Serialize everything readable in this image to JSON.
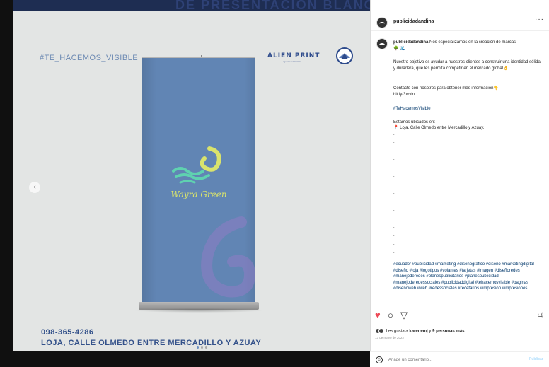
{
  "post_image": {
    "top_strip_text": "DE PRESENTACION BLANCOS",
    "hashtag": "#TE_HACEMOS_VISIBLE",
    "brand_name": "ALIEN PRINT",
    "brand_sub": "agencia publicitaria",
    "banner_logo": "Wayra Green",
    "phone": "098-365-4286",
    "address": "LOJA, CALLE OLMEDO ENTRE MERCADILLO Y AZUAY",
    "prev_icon": "‹",
    "colors": {
      "banner": "#6185b4",
      "text": "#33518a",
      "logo_yellow": "#d9e36c",
      "logo_green": "#5fd2b0"
    }
  },
  "header": {
    "username": "publicidadandina",
    "more": "···"
  },
  "caption": {
    "username": "publicidadandina",
    "line1": "Nos especializamos en la creación de marcas",
    "emojis1": "🌳 🌊",
    "p2": "Nuestro objetivo es ayudar a nuestros clientes a construir una identidad sólida y duradera, que les permita competir en el mercado global👌",
    "p3": "Contacte con nosotros para obtener más información👇",
    "link": "bit.ly/3xrvinl",
    "hashtag": "#TeHacemosVisible",
    "loc_label": "Estamos ubicados en:",
    "loc_value": "📍 Loja, Calle Olmedo entre Mercadillo y Azuay.",
    "dot": ".",
    "tags": "#ecuador #publicidad #marketing #diseñografico #diseño #marketingdigital #diseño #loja #logotipos #volantes #tarjetas #imagen #diseñoredes #manejoderedes #planespublicitarios #planespublicidad #manejoderedessociales #publicidaddigital #tehacemosvisible #paginas #diseñoweb #web #redessociales #recetarios #impresion #impresiones"
  },
  "actions": {
    "like_icon": "♥",
    "comment_icon": "○",
    "share_icon": "▽",
    "save_icon": "⌑"
  },
  "likes": {
    "prefix": "Les gusta a",
    "user": "karenemj",
    "middle": "y",
    "others": "9 personas más"
  },
  "date": "13 de mayo de 2022",
  "comment": {
    "emoji_icon": "☺",
    "placeholder": "Añade un comentario...",
    "publish": "Publicar"
  }
}
